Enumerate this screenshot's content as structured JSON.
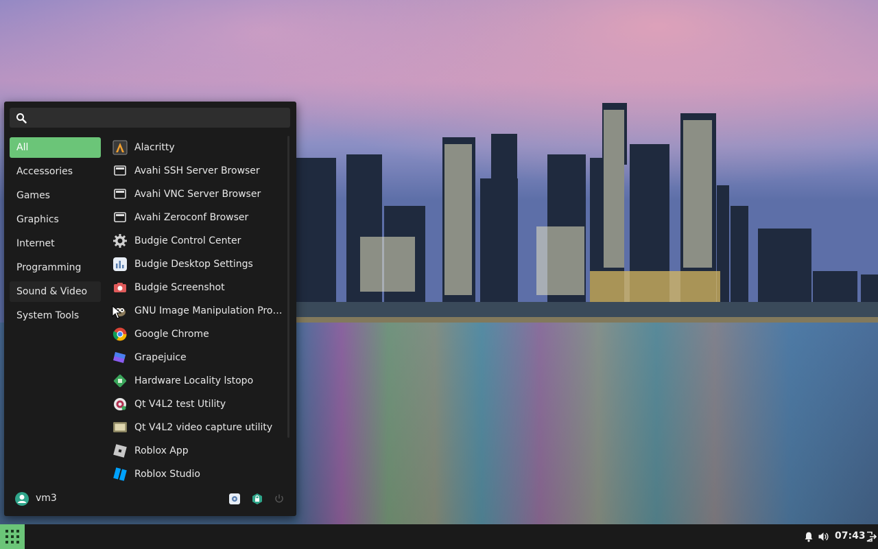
{
  "search": {
    "placeholder": "",
    "value": ""
  },
  "categories": [
    {
      "label": "All",
      "active": true
    },
    {
      "label": "Accessories"
    },
    {
      "label": "Games"
    },
    {
      "label": "Graphics"
    },
    {
      "label": "Internet"
    },
    {
      "label": "Programming"
    },
    {
      "label": "Sound & Video",
      "hovered": true
    },
    {
      "label": "System Tools"
    }
  ],
  "apps": [
    {
      "label": "Alacritty",
      "icon": "alacritty-icon"
    },
    {
      "label": "Avahi SSH Server Browser",
      "icon": "network-browser-icon"
    },
    {
      "label": "Avahi VNC Server Browser",
      "icon": "network-browser-icon"
    },
    {
      "label": "Avahi Zeroconf Browser",
      "icon": "network-browser-icon"
    },
    {
      "label": "Budgie Control Center",
      "icon": "gear-icon"
    },
    {
      "label": "Budgie Desktop Settings",
      "icon": "desktop-settings-icon"
    },
    {
      "label": "Budgie Screenshot",
      "icon": "camera-icon"
    },
    {
      "label": "GNU Image Manipulation Program",
      "icon": "gimp-icon"
    },
    {
      "label": "Google Chrome",
      "icon": "chrome-icon"
    },
    {
      "label": "Grapejuice",
      "icon": "grapejuice-icon"
    },
    {
      "label": "Hardware Locality lstopo",
      "icon": "lstopo-icon"
    },
    {
      "label": "Qt V4L2 test Utility",
      "icon": "qv4l2-icon"
    },
    {
      "label": "Qt V4L2 video capture utility",
      "icon": "video-capture-icon"
    },
    {
      "label": "Roblox App",
      "icon": "roblox-icon"
    },
    {
      "label": "Roblox Studio",
      "icon": "roblox-studio-icon"
    }
  ],
  "user": {
    "name": "vm3"
  },
  "panel": {
    "clock": "07:43"
  },
  "colors": {
    "accent": "#6bc578",
    "menu_bg": "#1b1b1b",
    "panel_bg": "#1a1a1a"
  }
}
